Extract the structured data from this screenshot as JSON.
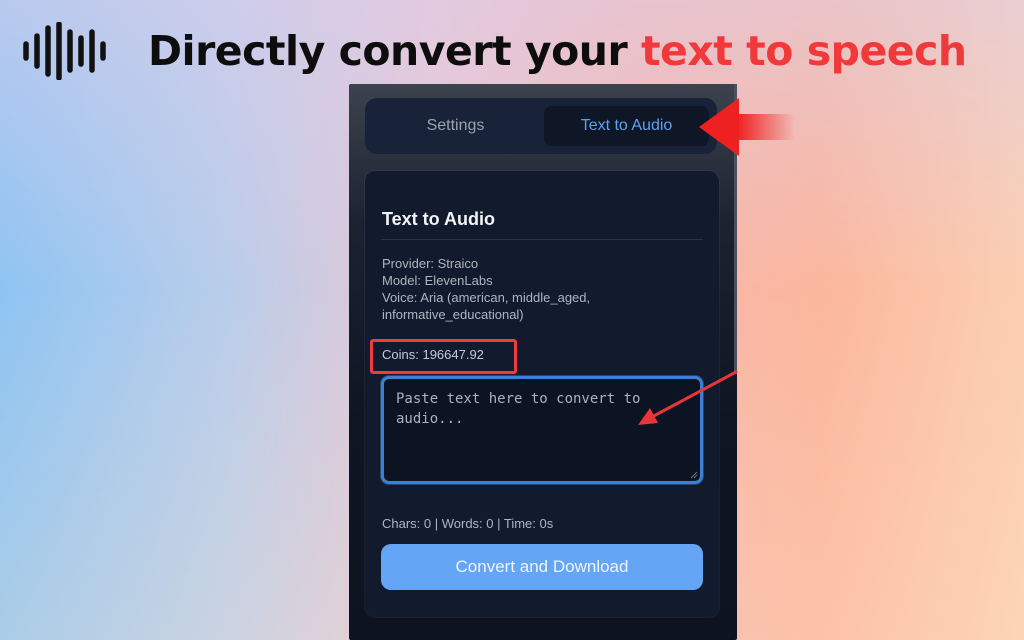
{
  "headline": {
    "prefix": "Directly convert your ",
    "accent": "text to speech"
  },
  "tabs": [
    {
      "label": "Settings",
      "active": false
    },
    {
      "label": "Text to Audio",
      "active": true
    }
  ],
  "card": {
    "title": "Text to Audio",
    "provider": "Provider: Straico",
    "model": "Model: ElevenLabs",
    "voice": "Voice: Aria (american, middle_aged, informative_educational)",
    "coins": "Coins: 196647.92"
  },
  "input": {
    "placeholder": "Paste text here to convert to audio...",
    "value": ""
  },
  "stats": "Chars: 0 | Words: 0 | Time: 0s",
  "convert_button": "Convert and Download",
  "colors": {
    "accent_red": "#f0393a",
    "button_blue": "#64a5f5",
    "active_tab_text": "#5aa2f3"
  },
  "icons": [
    "soundwave-icon",
    "arrow-left-icon",
    "arrow-pointer-icon"
  ]
}
